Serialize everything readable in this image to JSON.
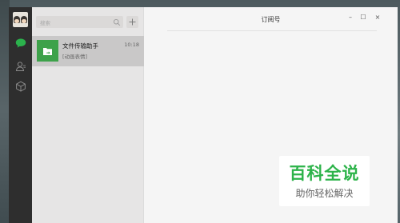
{
  "rail": {
    "icons": [
      "avatar",
      "chat-icon",
      "contacts-icon",
      "favorites-icon"
    ],
    "accent": "#2bb24c"
  },
  "search": {
    "placeholder": "搜索"
  },
  "chats": [
    {
      "name": "文件传输助手",
      "time": "10:18",
      "preview": "[动画表情]",
      "icon": "file-transfer-icon",
      "color": "#3da24a"
    }
  ],
  "main": {
    "title": "订阅号"
  },
  "window": {
    "minimize": "–",
    "maximize": "☐",
    "close": "×"
  },
  "watermark": {
    "title": "百科全说",
    "subtitle": "助你轻松解决"
  }
}
